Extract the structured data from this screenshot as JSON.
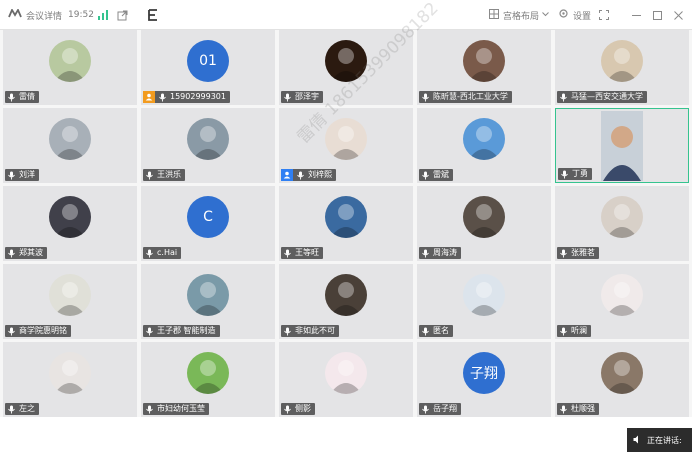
{
  "titlebar": {
    "meeting_info": "会议详情",
    "time": "19:52",
    "layout_label": "宫格布局",
    "settings_label": "设置"
  },
  "watermark": "雷倩 18615399098182",
  "tiles": [
    {
      "name": "雷倩",
      "type": "photo",
      "bg": "#b8c9a0"
    },
    {
      "name": "15902999301",
      "type": "text",
      "avatar_text": "01",
      "bg": "#2f6fd0",
      "host": true
    },
    {
      "name": "邵泽宇",
      "type": "photo",
      "bg": "#2b1a10"
    },
    {
      "name": "陈昕慧-西北工业大学",
      "type": "photo",
      "bg": "#7a5a4a"
    },
    {
      "name": "马猛—西安交通大学",
      "type": "photo",
      "bg": "#d8c8b0"
    },
    {
      "name": "刘洋",
      "type": "photo",
      "bg": "#a8b0b8"
    },
    {
      "name": "王洪乐",
      "type": "photo",
      "bg": "#8a9aa6"
    },
    {
      "name": "刘梓熙",
      "type": "photo",
      "bg": "#e8ddd4",
      "person": true
    },
    {
      "name": "雷斌",
      "type": "photo",
      "bg": "#5a9ad8"
    },
    {
      "name": "丁勇",
      "type": "video",
      "bg": "#c5ccd3",
      "active": true
    },
    {
      "name": "郑其波",
      "type": "photo",
      "bg": "#40404a"
    },
    {
      "name": "c.Hai",
      "type": "text",
      "avatar_text": "C",
      "bg": "#2f6fd0"
    },
    {
      "name": "王等旺",
      "type": "photo",
      "bg": "#3a6aa0"
    },
    {
      "name": "周海涛",
      "type": "photo",
      "bg": "#5a5048"
    },
    {
      "name": "张雅茗",
      "type": "photo",
      "bg": "#d8d0c8"
    },
    {
      "name": "商学院惠明铭",
      "type": "photo",
      "bg": "#e0e0d8"
    },
    {
      "name": "王子郡 智能制造",
      "type": "photo",
      "bg": "#7a9aa8"
    },
    {
      "name": "非如此不可",
      "type": "photo",
      "bg": "#4a4038"
    },
    {
      "name": "匿名",
      "type": "photo",
      "bg": "#dce4ec"
    },
    {
      "name": "听澜",
      "type": "photo",
      "bg": "#f0eaea"
    },
    {
      "name": "左之",
      "type": "photo",
      "bg": "#e8e4e2"
    },
    {
      "name": "市妇幼何玉莹",
      "type": "photo",
      "bg": "#7ab858"
    },
    {
      "name": "侧影",
      "type": "photo",
      "bg": "#f4e8ec"
    },
    {
      "name": "岳子翔",
      "type": "text",
      "avatar_text": "子翔",
      "bg": "#2f6fd0"
    },
    {
      "name": "杜顺强",
      "type": "photo",
      "bg": "#8a7868"
    }
  ],
  "speaking_label": "正在讲话:",
  "colors": {
    "accent": "#35c38f",
    "avatar_blue": "#2f6fd0",
    "host_badge": "#f29b1f"
  }
}
